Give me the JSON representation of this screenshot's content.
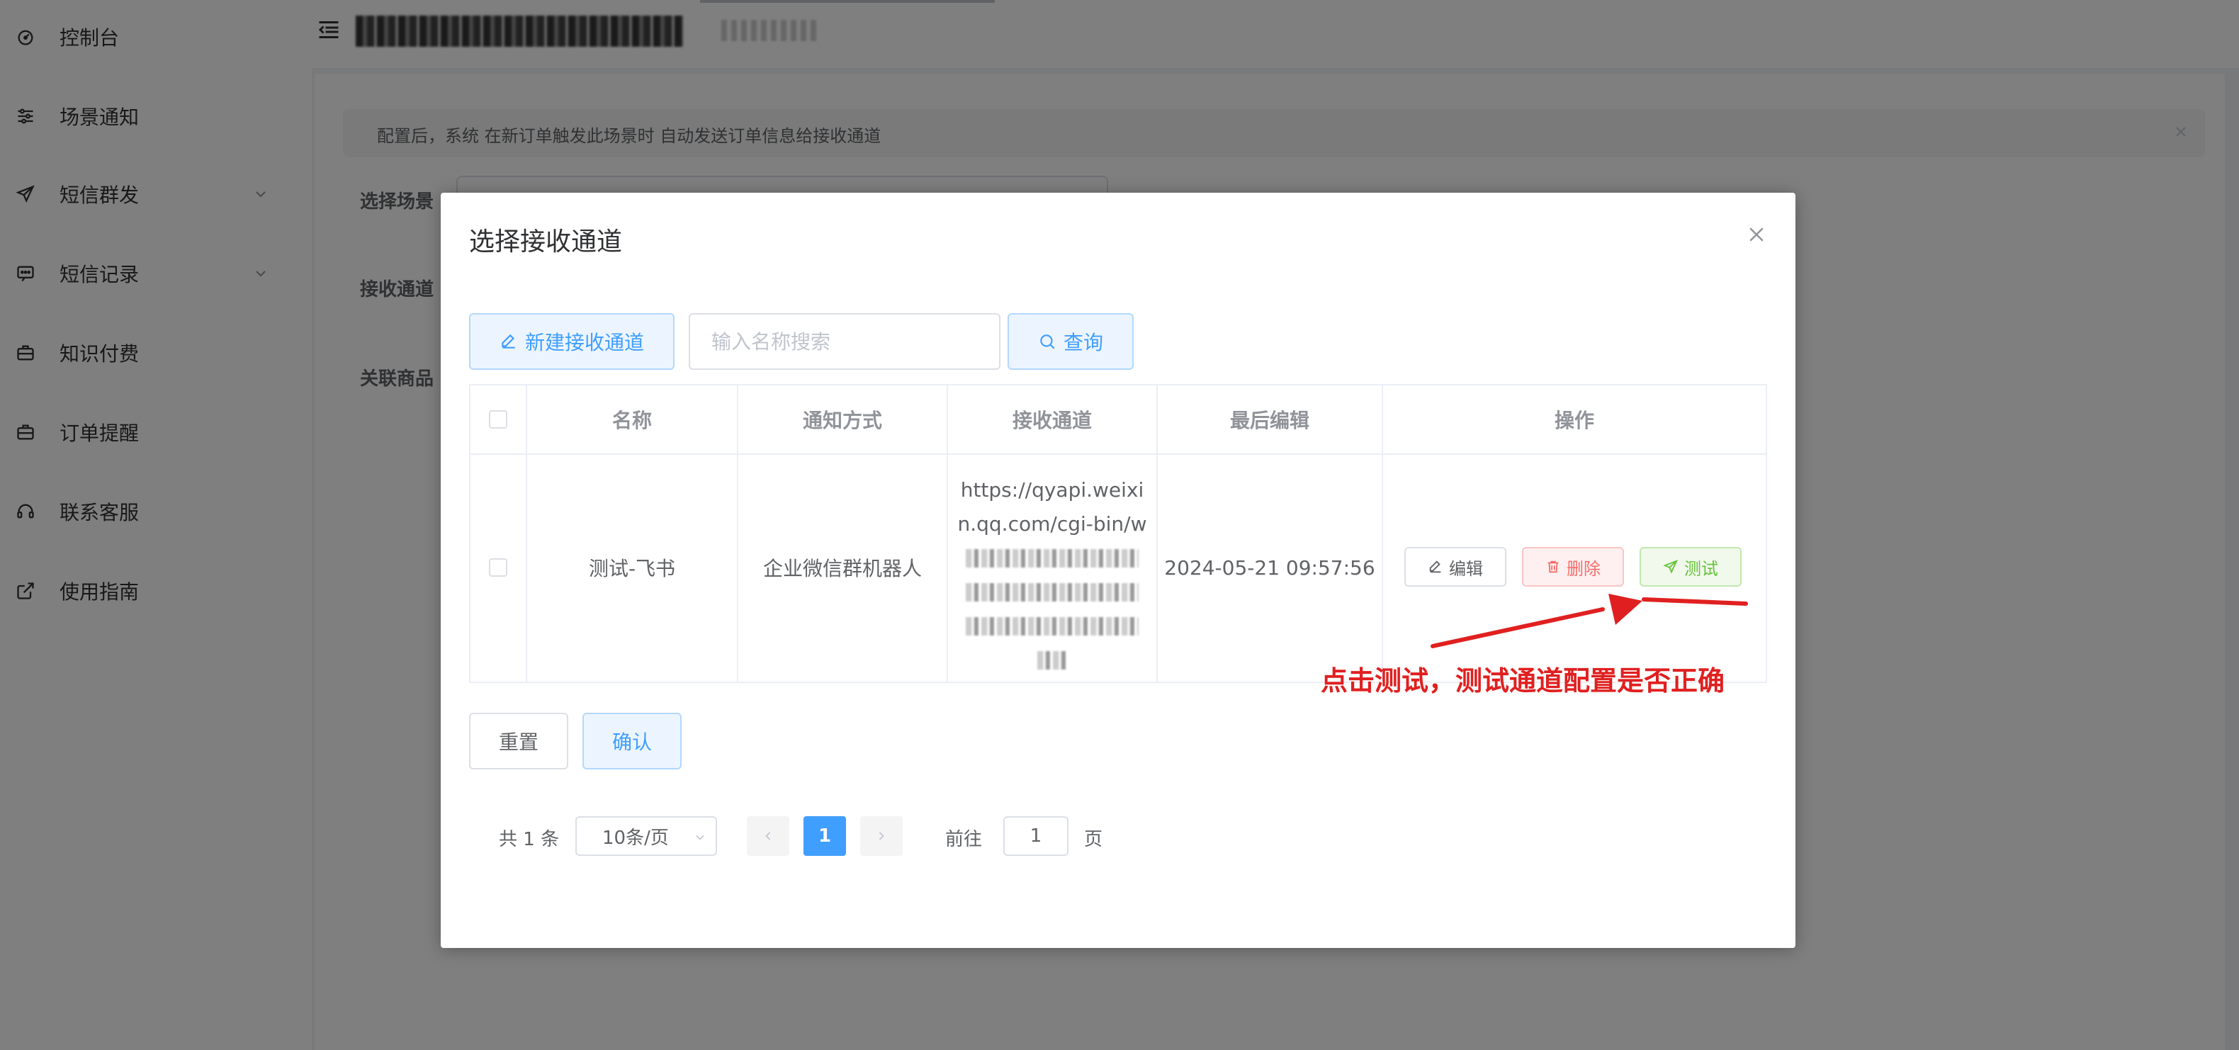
{
  "sidebar": {
    "items": [
      {
        "label": "控制台",
        "icon": "dashboard-icon"
      },
      {
        "label": "场景通知",
        "icon": "sliders-icon"
      },
      {
        "label": "短信群发",
        "icon": "send-icon",
        "expandable": true
      },
      {
        "label": "短信记录",
        "icon": "message-icon",
        "expandable": true
      },
      {
        "label": "知识付费",
        "icon": "briefcase-icon"
      },
      {
        "label": "订单提醒",
        "icon": "briefcase-icon"
      },
      {
        "label": "联系客服",
        "icon": "headset-icon"
      },
      {
        "label": "使用指南",
        "icon": "external-link-icon"
      }
    ]
  },
  "page": {
    "alert": "配置后，系统 在新订单触发此场景时 自动发送订单信息给接收通道",
    "labels": {
      "scene": "选择场景",
      "channel": "接收通道",
      "goods": "关联商品"
    }
  },
  "dialog": {
    "title": "选择接收通道",
    "new_button": "新建接收通道",
    "search_placeholder": "输入名称搜索",
    "search_button": "查询",
    "columns": [
      "名称",
      "通知方式",
      "接收通道",
      "最后编辑",
      "操作"
    ],
    "rows": [
      {
        "name": "测试-飞书",
        "method": "企业微信群机器人",
        "channel_lines": [
          "https://qyapi.weixi",
          "n.qq.com/cgi-bin/w"
        ],
        "last_edit": "2024-05-21 09:57:56",
        "actions": {
          "edit": "编辑",
          "delete": "删除",
          "test": "测试"
        }
      }
    ],
    "reset_button": "重置",
    "confirm_button": "确认",
    "pagination": {
      "total": "共 1 条",
      "page_size": "10条/页",
      "current_page": "1",
      "goto_label": "前往",
      "goto_value": "1",
      "page_suffix": "页"
    }
  },
  "annotation": "点击测试，测试通道配置是否正确",
  "colors": {
    "primary": "#409eff",
    "danger": "#f56c6c",
    "success": "#67c23a",
    "annotation": "#e02020"
  }
}
